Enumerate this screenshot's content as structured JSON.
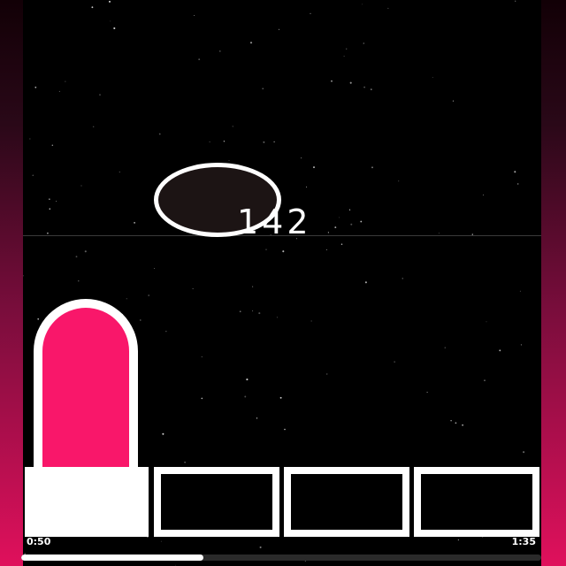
{
  "game": {
    "score": "142",
    "hold_note_color": "#f9176a",
    "edge_gradient_color": "#e0105c",
    "lanes": [
      {
        "state": "tapped"
      },
      {
        "state": "empty"
      },
      {
        "state": "empty"
      },
      {
        "state": "empty"
      }
    ]
  },
  "playback": {
    "elapsed": "0:50",
    "total": "1:35",
    "progress_fraction": 0.35
  }
}
